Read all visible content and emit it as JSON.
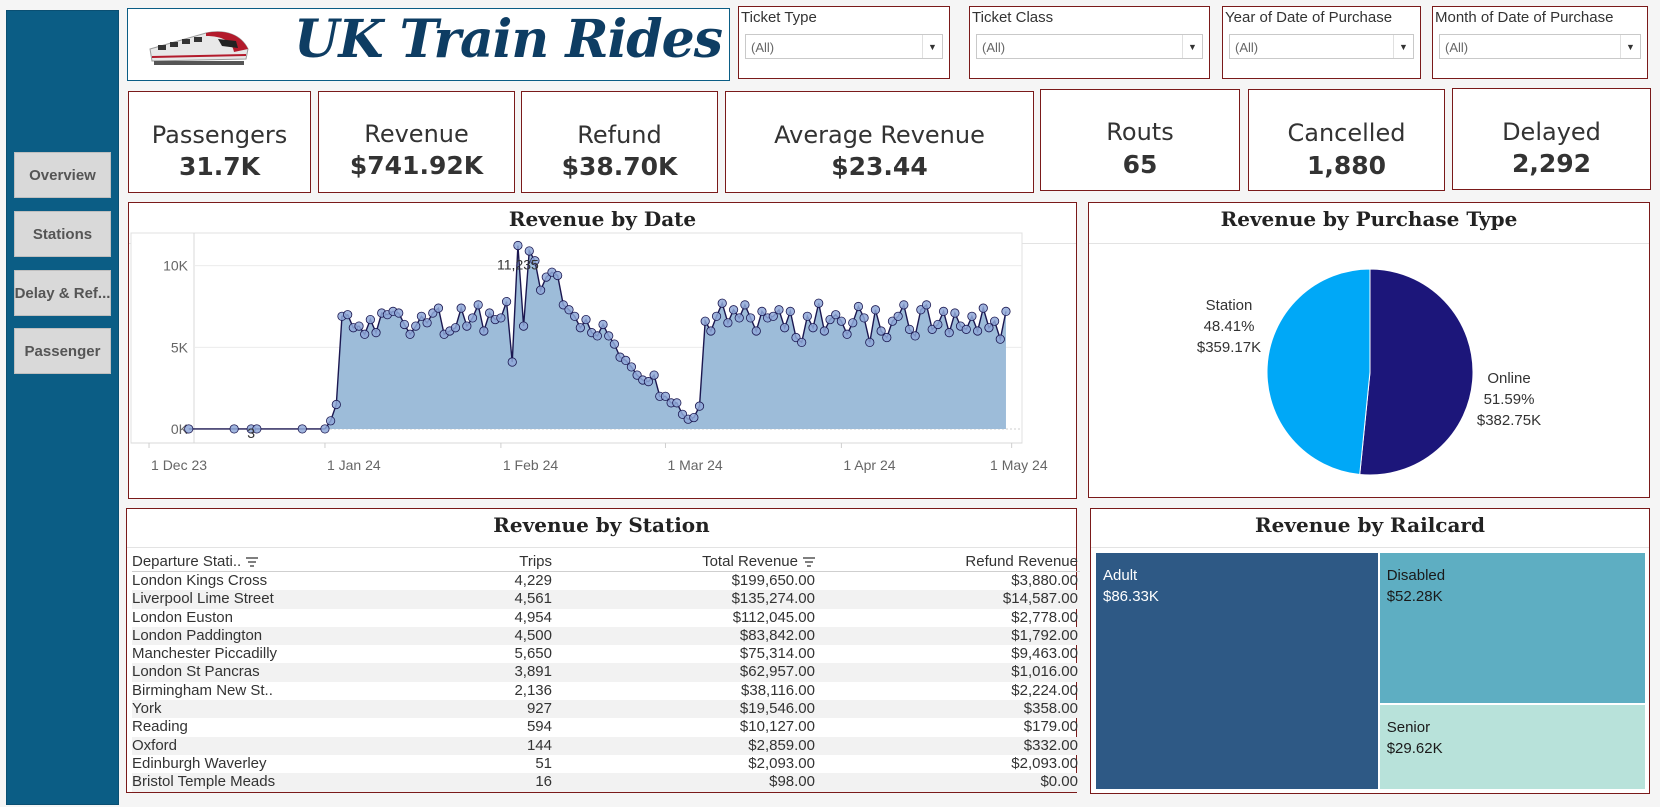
{
  "header": {
    "title": "UK Train Rides",
    "logo_icon": "train-icon"
  },
  "sidebar": {
    "items": [
      {
        "label": "Overview"
      },
      {
        "label": "Stations"
      },
      {
        "label": "Delay & Ref..."
      },
      {
        "label": "Passenger"
      }
    ]
  },
  "filters": [
    {
      "label": "Ticket Type",
      "value": "(All)"
    },
    {
      "label": "Ticket Class",
      "value": "(All)"
    },
    {
      "label": "Year of Date of Purchase",
      "value": "(All)"
    },
    {
      "label": "Month of Date of Purchase",
      "value": "(All)"
    }
  ],
  "kpis": [
    {
      "label": "Passengers",
      "value": "31.7K"
    },
    {
      "label": "Revenue",
      "value": "$741.92K"
    },
    {
      "label": "Refund",
      "value": "$38.70K"
    },
    {
      "label": "Average Revenue",
      "value": "$23.44"
    },
    {
      "label": "Routs",
      "value": "65"
    },
    {
      "label": "Cancelled",
      "value": "1,880"
    },
    {
      "label": "Delayed",
      "value": "2,292"
    }
  ],
  "revenue_by_date": {
    "title": "Revenue by Date",
    "peak_label": "11,235",
    "low_label": "3"
  },
  "purchase_type": {
    "title": "Revenue by Purchase Type"
  },
  "station_table": {
    "title": "Revenue by Station",
    "headers": [
      "Departure Stati..",
      "Trips",
      "Total Revenue",
      "Refund Revenue"
    ],
    "rows": [
      [
        "London Kings Cross",
        "4,229",
        "$199,650.00",
        "$3,880.00"
      ],
      [
        "Liverpool Lime Street",
        "4,561",
        "$135,274.00",
        "$14,587.00"
      ],
      [
        "London Euston",
        "4,954",
        "$112,045.00",
        "$2,778.00"
      ],
      [
        "London Paddington",
        "4,500",
        "$83,842.00",
        "$1,792.00"
      ],
      [
        "Manchester Piccadilly",
        "5,650",
        "$75,314.00",
        "$9,463.00"
      ],
      [
        "London St Pancras",
        "3,891",
        "$62,957.00",
        "$1,016.00"
      ],
      [
        "Birmingham New St..",
        "2,136",
        "$38,116.00",
        "$2,224.00"
      ],
      [
        "York",
        "927",
        "$19,546.00",
        "$358.00"
      ],
      [
        "Reading",
        "594",
        "$10,127.00",
        "$179.00"
      ],
      [
        "Oxford",
        "144",
        "$2,859.00",
        "$332.00"
      ],
      [
        "Edinburgh Waverley",
        "51",
        "$2,093.00",
        "$2,093.00"
      ],
      [
        "Bristol Temple Meads",
        "16",
        "$98.00",
        "$0.00"
      ]
    ]
  },
  "railcard": {
    "title": "Revenue by Railcard"
  },
  "colors": {
    "sidebar": "#0b5d85",
    "area_fill": "#9dbcd9",
    "line": "#1b1750",
    "marker": "#8fa8d8",
    "pie_station": "#00a8f7",
    "pie_online": "#1c167a",
    "tm_adult": "#2e5985",
    "tm_disabled": "#5eaec2",
    "tm_senior": "#b8e2da"
  },
  "chart_data": [
    {
      "type": "area",
      "title": "Revenue by Date",
      "x_ticks": [
        "1 Dec 23",
        "1 Jan 24",
        "1 Feb 24",
        "1 Mar 24",
        "1 Apr 24",
        "1 May 24"
      ],
      "y_ticks": [
        "0K",
        "5K",
        "10K"
      ],
      "ylim": [
        0,
        12000
      ],
      "x": [
        "2023-12-08",
        "2023-12-16",
        "2023-12-19",
        "2023-12-20",
        "2023-12-28",
        "2024-01-01",
        "2024-01-02",
        "2024-01-03",
        "2024-01-04",
        "2024-01-05",
        "2024-01-06",
        "2024-01-07",
        "2024-01-08",
        "2024-01-09",
        "2024-01-10",
        "2024-01-11",
        "2024-01-12",
        "2024-01-13",
        "2024-01-14",
        "2024-01-15",
        "2024-01-16",
        "2024-01-17",
        "2024-01-18",
        "2024-01-19",
        "2024-01-20",
        "2024-01-21",
        "2024-01-22",
        "2024-01-23",
        "2024-01-24",
        "2024-01-25",
        "2024-01-26",
        "2024-01-27",
        "2024-01-28",
        "2024-01-29",
        "2024-01-30",
        "2024-01-31",
        "2024-02-01",
        "2024-02-02",
        "2024-02-03",
        "2024-02-04",
        "2024-02-05",
        "2024-02-06",
        "2024-02-07",
        "2024-02-08",
        "2024-02-09",
        "2024-02-10",
        "2024-02-11",
        "2024-02-12",
        "2024-02-13",
        "2024-02-14",
        "2024-02-15",
        "2024-02-16",
        "2024-02-17",
        "2024-02-18",
        "2024-02-19",
        "2024-02-20",
        "2024-02-21",
        "2024-02-22",
        "2024-02-23",
        "2024-02-24",
        "2024-02-25",
        "2024-02-26",
        "2024-02-27",
        "2024-02-28",
        "2024-02-29",
        "2024-03-01",
        "2024-03-02",
        "2024-03-03",
        "2024-03-04",
        "2024-03-05",
        "2024-03-06",
        "2024-03-07",
        "2024-03-08",
        "2024-03-09",
        "2024-03-10",
        "2024-03-11",
        "2024-03-12",
        "2024-03-13",
        "2024-03-14",
        "2024-03-15",
        "2024-03-16",
        "2024-03-17",
        "2024-03-18",
        "2024-03-19",
        "2024-03-20",
        "2024-03-21",
        "2024-03-22",
        "2024-03-23",
        "2024-03-24",
        "2024-03-25",
        "2024-03-26",
        "2024-03-27",
        "2024-03-28",
        "2024-03-29",
        "2024-03-30",
        "2024-03-31",
        "2024-04-01",
        "2024-04-02",
        "2024-04-03",
        "2024-04-04",
        "2024-04-05",
        "2024-04-06",
        "2024-04-07",
        "2024-04-08",
        "2024-04-09",
        "2024-04-10",
        "2024-04-11",
        "2024-04-12",
        "2024-04-13",
        "2024-04-14",
        "2024-04-15",
        "2024-04-16",
        "2024-04-17",
        "2024-04-18",
        "2024-04-19",
        "2024-04-20",
        "2024-04-21",
        "2024-04-22",
        "2024-04-23",
        "2024-04-24",
        "2024-04-25",
        "2024-04-26",
        "2024-04-27",
        "2024-04-28",
        "2024-04-29",
        "2024-04-30"
      ],
      "values": [
        5,
        5,
        3,
        5,
        5,
        5,
        500,
        1500,
        6900,
        7000,
        6200,
        6300,
        5800,
        6700,
        5900,
        7100,
        7000,
        7200,
        7100,
        6400,
        5800,
        6300,
        6900,
        6500,
        7100,
        7400,
        5800,
        6000,
        6200,
        7400,
        6300,
        6800,
        7600,
        6000,
        7100,
        6700,
        6800,
        7800,
        4100,
        11235,
        6300,
        10900,
        10300,
        8500,
        9300,
        9600,
        9400,
        7600,
        7300,
        6900,
        6200,
        6700,
        5900,
        5700,
        6400,
        5700,
        5200,
        4400,
        4200,
        3800,
        3300,
        3000,
        2900,
        3300,
        2000,
        2000,
        1600,
        1600,
        900,
        600,
        700,
        1400,
        6600,
        6000,
        6900,
        7700,
        6500,
        7300,
        6800,
        7600,
        6800,
        6000,
        7200,
        6800,
        6900,
        7300,
        6200,
        7200,
        5600,
        5300,
        6900,
        6200,
        7700,
        6000,
        6700,
        7000,
        6600,
        5800,
        6500,
        7500,
        6800,
        5300,
        7300,
        6000,
        5600,
        6600,
        6900,
        7600,
        6100,
        5700,
        7300,
        7600,
        6100,
        6400,
        7200,
        5900,
        7100,
        6300,
        6100,
        6900,
        6000,
        7400,
        6200,
        6600,
        5500,
        7200,
        6800,
        8100,
        6000,
        7100,
        6800,
        6500,
        5700,
        6700,
        5900,
        6800,
        6500,
        3600
      ],
      "annotations": [
        {
          "x": "2024-02-04",
          "label": "11,235"
        },
        {
          "x": "2023-12-19",
          "label": "3"
        }
      ]
    },
    {
      "type": "pie",
      "title": "Revenue by Purchase Type",
      "categories": [
        "Station",
        "Online"
      ],
      "values": [
        359.17,
        382.75
      ],
      "percent_labels": [
        "48.41%",
        "51.59%"
      ],
      "value_labels": [
        "$359.17K",
        "$382.75K"
      ],
      "units": "K$"
    },
    {
      "type": "treemap",
      "title": "Revenue by Railcard",
      "categories": [
        "Adult",
        "Disabled",
        "Senior"
      ],
      "values": [
        86.33,
        52.28,
        29.62
      ],
      "value_labels": [
        "$86.33K",
        "$52.28K",
        "$29.62K"
      ],
      "units": "K$"
    }
  ]
}
